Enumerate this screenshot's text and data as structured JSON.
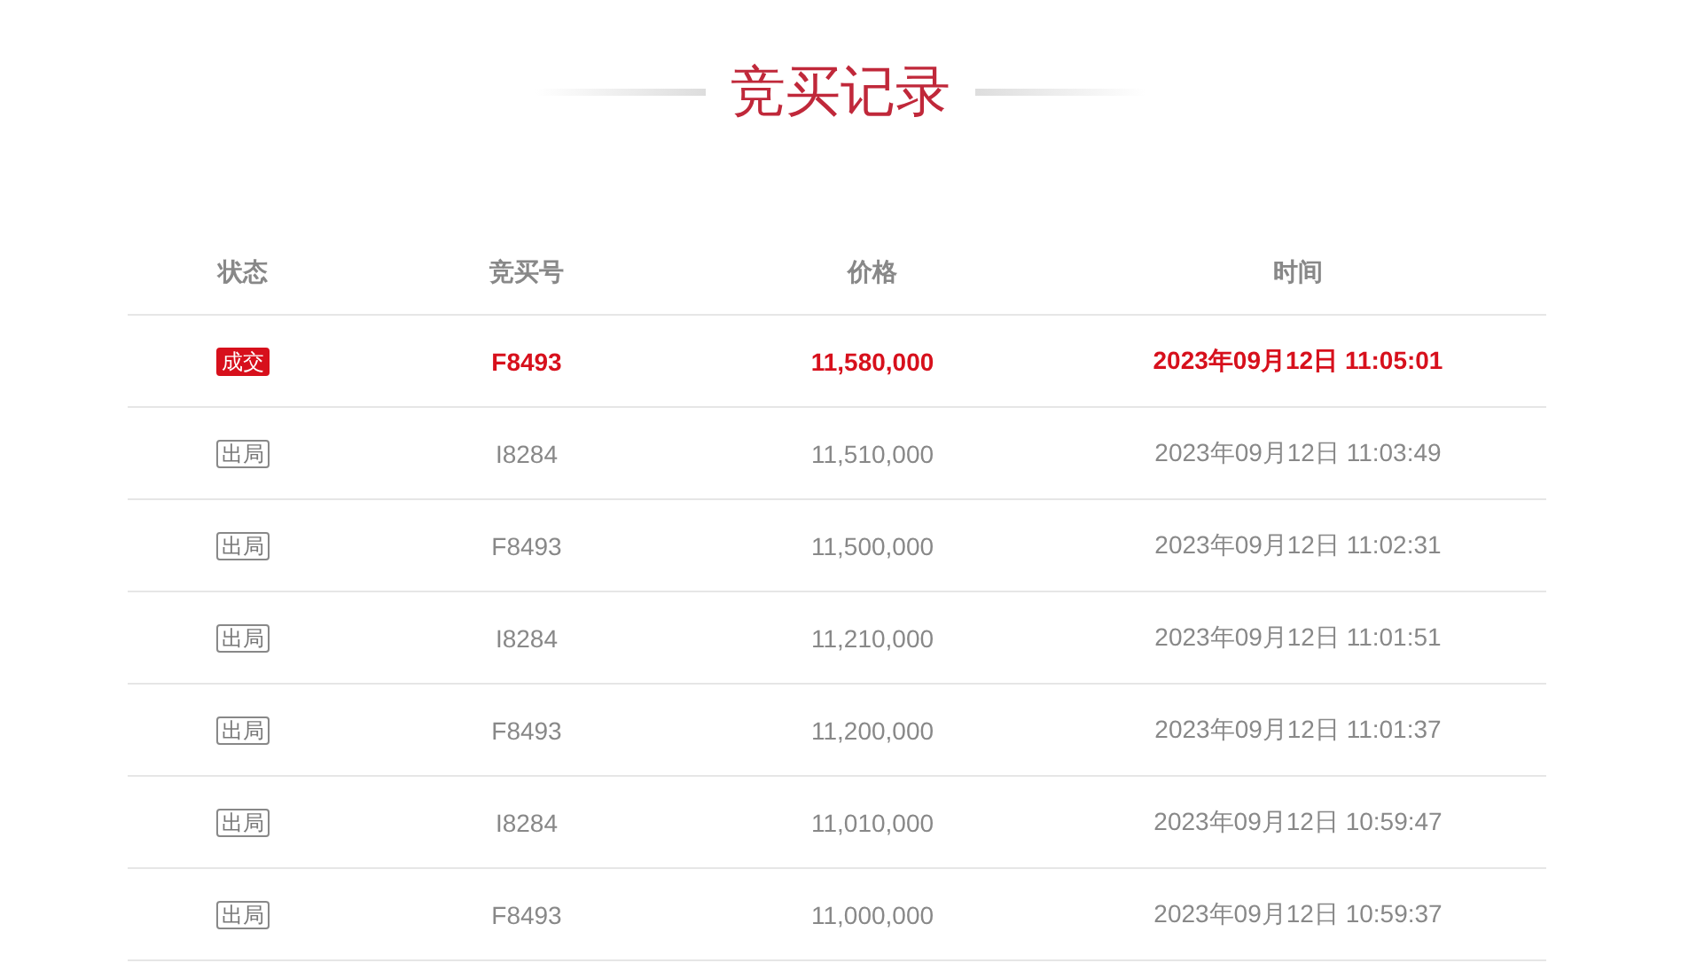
{
  "title": "竞买记录",
  "table": {
    "columns": [
      "状态",
      "竞买号",
      "价格",
      "时间"
    ],
    "rows": [
      {
        "kind": "deal",
        "status": "成交",
        "bidder": "F8493",
        "price": "11,580,000",
        "time": "2023年09月12日 11:05:01"
      },
      {
        "kind": "out",
        "status": "出局",
        "bidder": "I8284",
        "price": "11,510,000",
        "time": "2023年09月12日 11:03:49"
      },
      {
        "kind": "out",
        "status": "出局",
        "bidder": "F8493",
        "price": "11,500,000",
        "time": "2023年09月12日 11:02:31"
      },
      {
        "kind": "out",
        "status": "出局",
        "bidder": "I8284",
        "price": "11,210,000",
        "time": "2023年09月12日 11:01:51"
      },
      {
        "kind": "out",
        "status": "出局",
        "bidder": "F8493",
        "price": "11,200,000",
        "time": "2023年09月12日 11:01:37"
      },
      {
        "kind": "out",
        "status": "出局",
        "bidder": "I8284",
        "price": "11,010,000",
        "time": "2023年09月12日 10:59:47"
      },
      {
        "kind": "out",
        "status": "出局",
        "bidder": "F8493",
        "price": "11,000,000",
        "time": "2023年09月12日 10:59:37"
      }
    ]
  }
}
